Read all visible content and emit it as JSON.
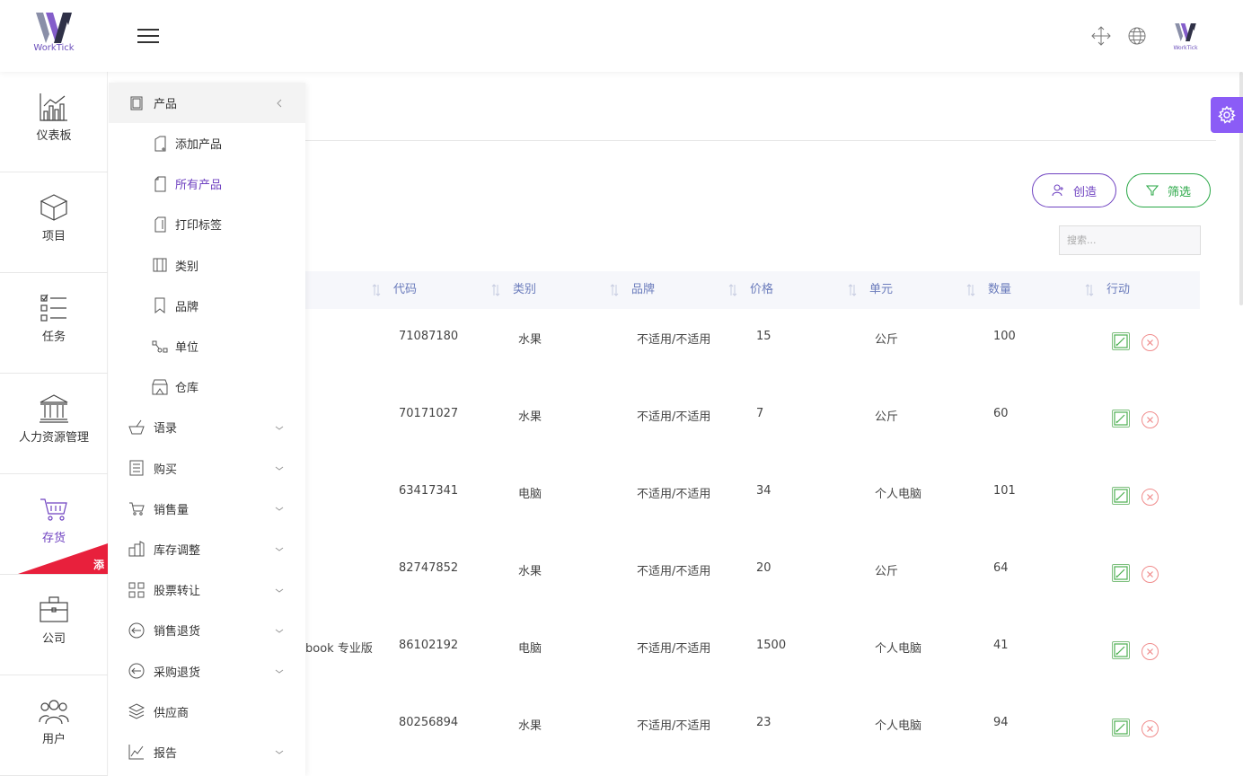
{
  "header": {
    "logo_text": "WorkTick",
    "small_logo_text": "WorkTick"
  },
  "rail": {
    "items": [
      {
        "label": "仪表板",
        "icon": "chart-icon"
      },
      {
        "label": "项目",
        "icon": "box-icon"
      },
      {
        "label": "任务",
        "icon": "checklist-icon"
      },
      {
        "label": "人力资源管理",
        "icon": "bank-icon"
      },
      {
        "label": "存货",
        "icon": "cart-icon"
      },
      {
        "label": "公司",
        "icon": "briefcase-icon"
      },
      {
        "label": "用户",
        "icon": "users-icon"
      }
    ],
    "corner_badge": "添"
  },
  "submenu": {
    "title": "产品",
    "children": [
      "添加产品",
      "所有产品",
      "打印标签",
      "类别",
      "品牌",
      "单位",
      "仓库"
    ],
    "sections": [
      "语录",
      "购买",
      "销售量",
      "库存调整",
      "股票转让",
      "销售退货",
      "采购退货",
      "供应商",
      "报告"
    ]
  },
  "toolbar": {
    "create_label": "创造",
    "filter_label": "筛选",
    "search_placeholder": "搜索..."
  },
  "table": {
    "columns": [
      "代码",
      "类别",
      "品牌",
      "价格",
      "单元",
      "数量",
      "行动"
    ],
    "partial_name_row5": "book 专业版",
    "rows": [
      {
        "code": "71087180",
        "category": "水果",
        "brand": "不适用/不适用",
        "price": "15",
        "unit": "公斤",
        "qty": "100"
      },
      {
        "code": "70171027",
        "category": "水果",
        "brand": "不适用/不适用",
        "price": "7",
        "unit": "公斤",
        "qty": "60"
      },
      {
        "code": "63417341",
        "category": "电脑",
        "brand": "不适用/不适用",
        "price": "34",
        "unit": "个人电脑",
        "qty": "101"
      },
      {
        "code": "82747852",
        "category": "水果",
        "brand": "不适用/不适用",
        "price": "20",
        "unit": "公斤",
        "qty": "64"
      },
      {
        "code": "86102192",
        "category": "电脑",
        "brand": "不适用/不适用",
        "price": "1500",
        "unit": "个人电脑",
        "qty": "41"
      },
      {
        "code": "80256894",
        "category": "水果",
        "brand": "不适用/不适用",
        "price": "23",
        "unit": "个人电脑",
        "qty": "94"
      }
    ]
  },
  "colors": {
    "primary": "#6f42c1",
    "success": "#28a745",
    "danger": "#e8203c",
    "gear": "#8b5cf6"
  }
}
